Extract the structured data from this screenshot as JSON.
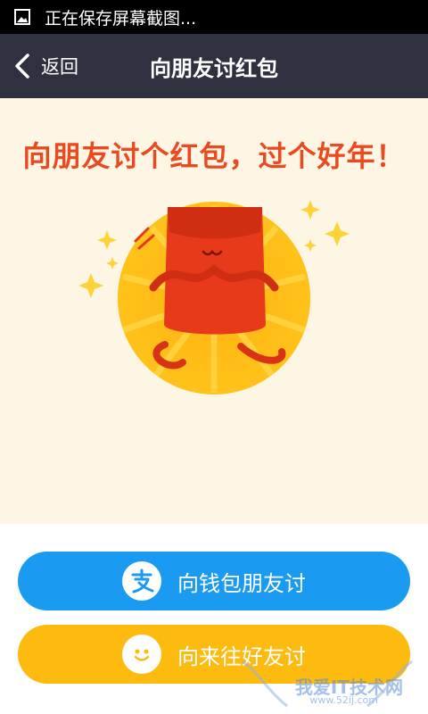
{
  "status_bar": {
    "text": "正在保存屏幕截图..."
  },
  "nav": {
    "back_label": "返回",
    "title": "向朋友讨红包"
  },
  "hero": {
    "headline": "向朋友讨个红包，过个好年！"
  },
  "buttons": {
    "wallet": {
      "label": "向钱包朋友讨",
      "color": "#1a9af0"
    },
    "friends": {
      "label": "向来往好友讨",
      "color": "#fdbb10"
    }
  },
  "watermark": {
    "text": "我爱IT技术网",
    "sub": "www.52ij.com"
  },
  "colors": {
    "nav_bg": "#2f3140",
    "hero_bg": "#fdf6e4",
    "headline": "#e94a1f"
  },
  "icons": [
    "image-icon",
    "back-chevron-icon",
    "red-envelope-illustration",
    "alipay-icon",
    "laiwang-smiley-icon"
  ]
}
